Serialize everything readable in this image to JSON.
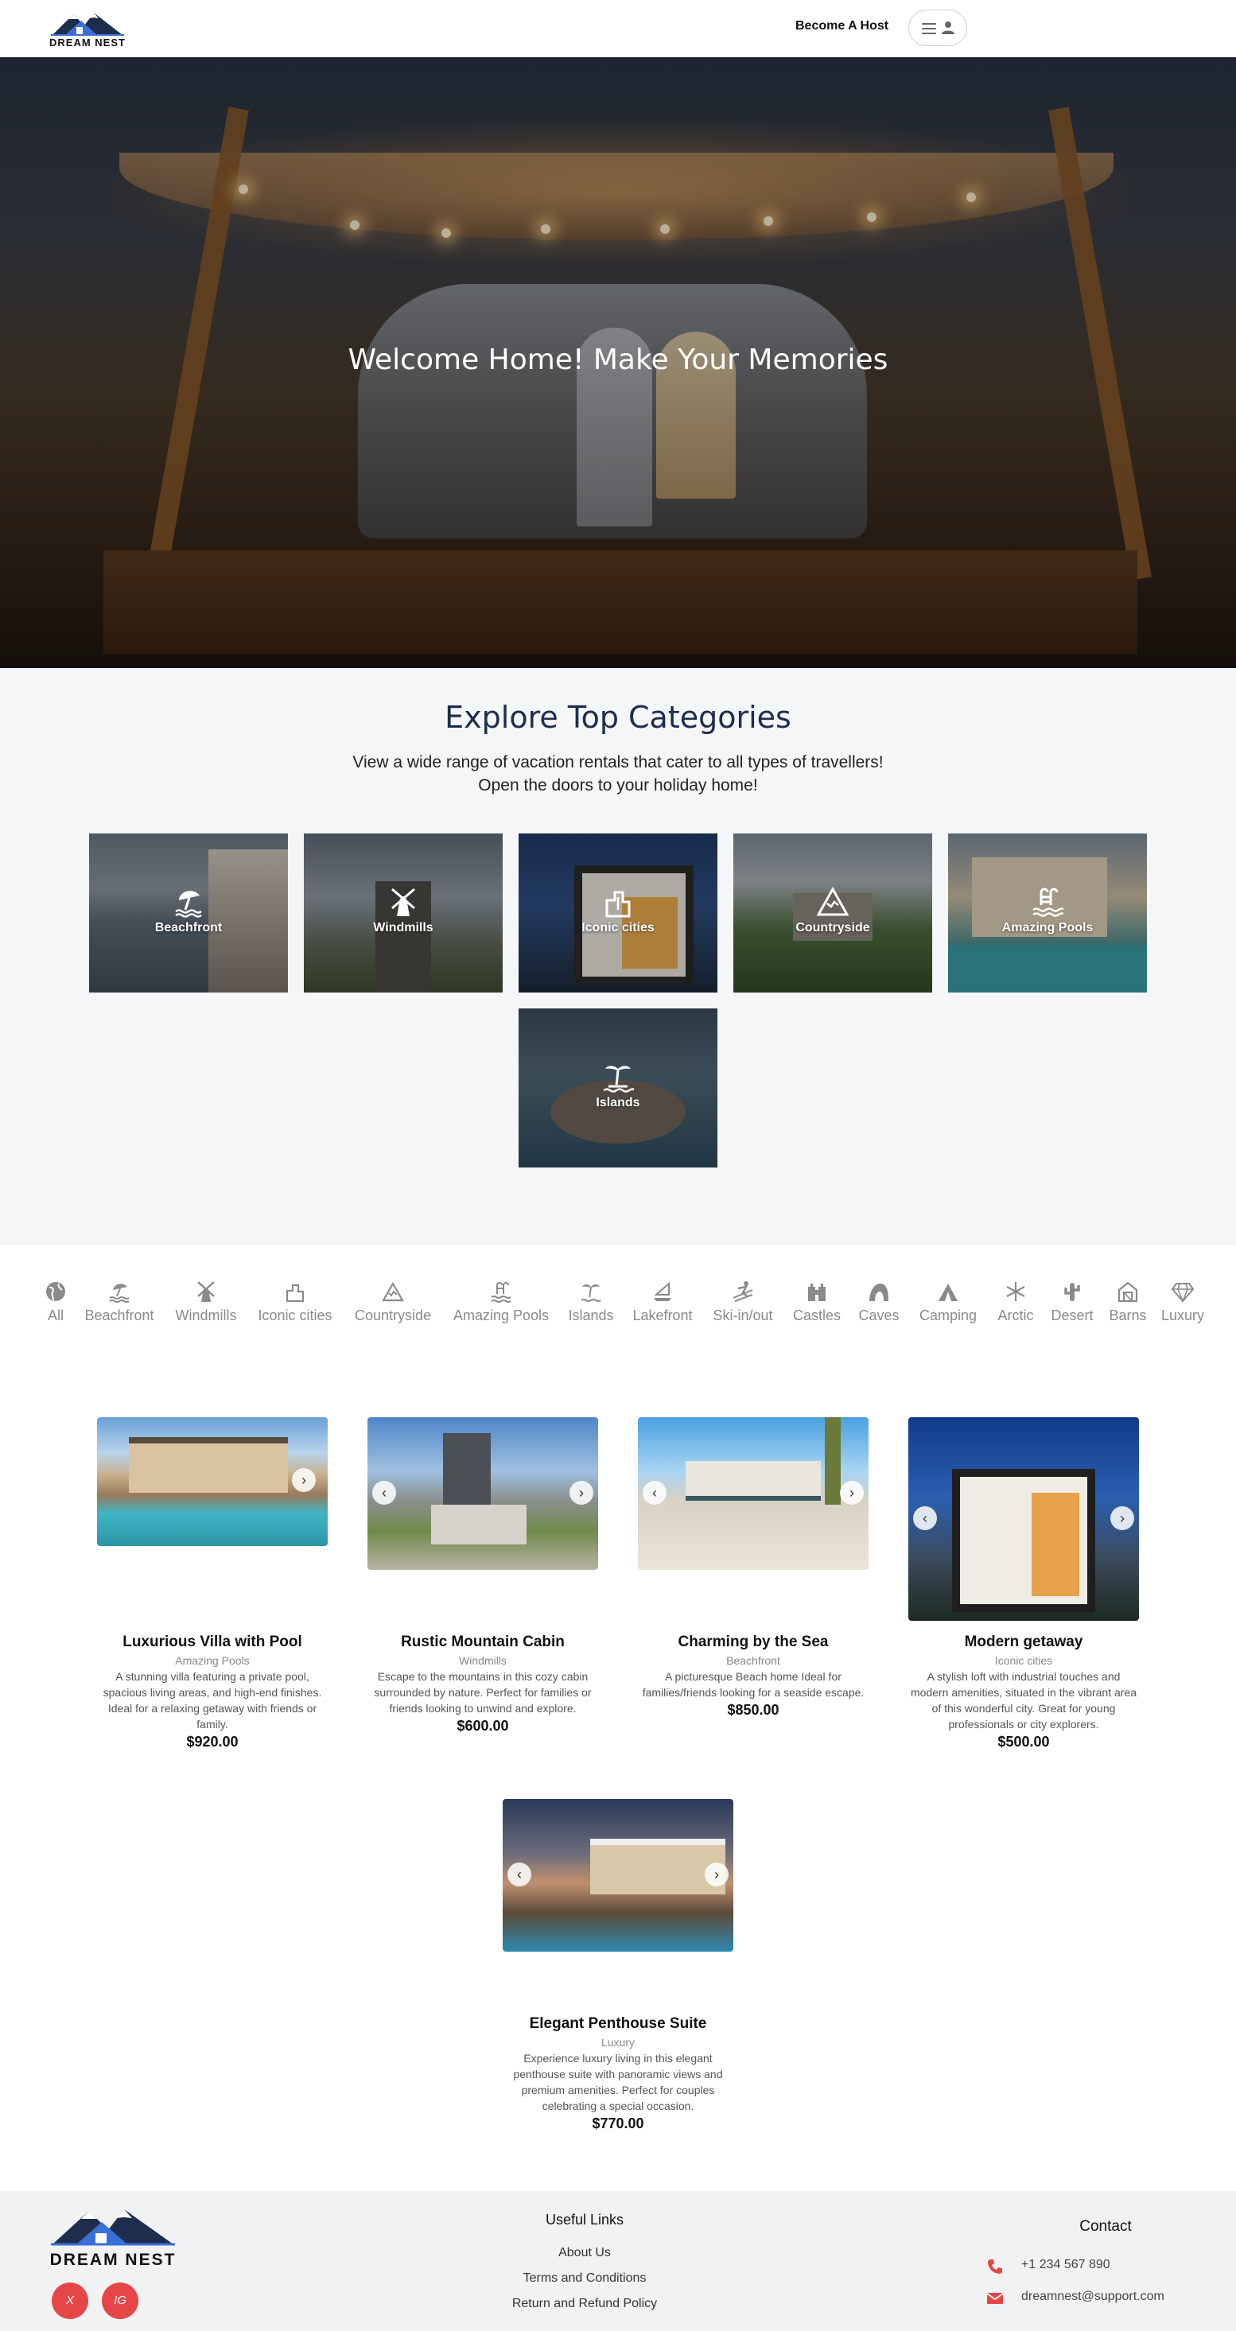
{
  "header": {
    "logo_text": "DREAM NEST",
    "host_link": "Become A Host"
  },
  "hero": {
    "title": "Welcome Home! Make Your Memories"
  },
  "categories_section": {
    "title": "Explore Top Categories",
    "subtitle_line1": "View a wide range of vacation rentals that cater to all types of travellers!",
    "subtitle_line2": "Open the doors to your holiday home!",
    "cards": [
      {
        "label": "Beachfront",
        "icon": "beach-umbrella-icon"
      },
      {
        "label": "Windmills",
        "icon": "windmill-icon"
      },
      {
        "label": "Iconic cities",
        "icon": "city-building-icon"
      },
      {
        "label": "Countryside",
        "icon": "mountain-icon"
      },
      {
        "label": "Amazing Pools",
        "icon": "pool-icon"
      },
      {
        "label": "Islands",
        "icon": "palm-island-icon"
      }
    ]
  },
  "filters": [
    {
      "label": "All",
      "icon": "globe-icon"
    },
    {
      "label": "Beachfront",
      "icon": "beach-umbrella-icon"
    },
    {
      "label": "Windmills",
      "icon": "windmill-icon"
    },
    {
      "label": "Iconic cities",
      "icon": "city-building-icon"
    },
    {
      "label": "Countryside",
      "icon": "mountain-icon"
    },
    {
      "label": "Amazing Pools",
      "icon": "pool-icon"
    },
    {
      "label": "Islands",
      "icon": "palm-island-icon"
    },
    {
      "label": "Lakefront",
      "icon": "boat-icon"
    },
    {
      "label": "Ski-in/out",
      "icon": "skier-icon"
    },
    {
      "label": "Castles",
      "icon": "castle-icon"
    },
    {
      "label": "Caves",
      "icon": "cave-icon"
    },
    {
      "label": "Camping",
      "icon": "tent-icon"
    },
    {
      "label": "Arctic",
      "icon": "snowflake-icon"
    },
    {
      "label": "Desert",
      "icon": "cactus-icon"
    },
    {
      "label": "Barns",
      "icon": "barn-icon"
    },
    {
      "label": "Luxury",
      "icon": "diamond-icon"
    }
  ],
  "listings": [
    {
      "title": "Luxurious Villa with Pool",
      "category": "Amazing Pools",
      "description": "A stunning villa featuring a private pool, spacious living areas, and high-end finishes. Ideal for a relaxing getaway with friends or family.",
      "price": "$920.00"
    },
    {
      "title": "Rustic Mountain Cabin",
      "category": "Windmills",
      "description": "Escape to the mountains in this cozy cabin surrounded by nature. Perfect for families or friends looking to unwind and explore.",
      "price": "$600.00"
    },
    {
      "title": "Charming by the Sea",
      "category": "Beachfront",
      "description": "A picturesque Beach home Ideal for families/friends looking for a seaside escape.",
      "price": "$850.00"
    },
    {
      "title": "Modern getaway",
      "category": "Iconic cities",
      "description": "A stylish loft with industrial touches and modern amenities, situated in the vibrant area of this wonderful city. Great for young professionals or city explorers.",
      "price": "$500.00"
    },
    {
      "title": "Elegant Penthouse Suite",
      "category": "Luxury",
      "description": "Experience luxury living in this elegant penthouse suite with panoramic views and premium amenities. Perfect for couples celebrating a special occasion.",
      "price": "$770.00"
    }
  ],
  "footer": {
    "logo_text": "DREAM NEST",
    "social": [
      "X",
      "IG"
    ],
    "useful_links_title": "Useful Links",
    "useful_links": [
      "About Us",
      "Terms and Conditions",
      "Return and Refund Policy"
    ],
    "contact_title": "Contact",
    "phone": "+1 234 567 890",
    "email": "dreamnest@support.com"
  },
  "colors": {
    "brand_navy": "#1e2d4d",
    "accent_red": "#e74646",
    "section_bg": "#f5f6f7",
    "footer_bg": "#f1f2f4"
  }
}
